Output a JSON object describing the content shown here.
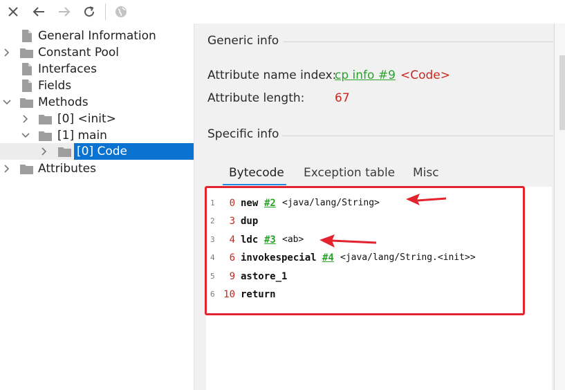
{
  "toolbar": {
    "buttons": [
      {
        "icon": "close-icon"
      },
      {
        "icon": "back-arrow-icon"
      },
      {
        "icon": "forward-arrow-icon"
      },
      {
        "icon": "refresh-icon"
      },
      {
        "icon": "globe-icon"
      }
    ]
  },
  "tree": {
    "items": [
      {
        "label": "General Information",
        "kind": "file"
      },
      {
        "label": "Constant Pool",
        "kind": "folder",
        "expanded": false
      },
      {
        "label": "Interfaces",
        "kind": "file"
      },
      {
        "label": "Fields",
        "kind": "file"
      },
      {
        "label": "Methods",
        "kind": "folder",
        "expanded": true
      },
      {
        "label": "[0] <init>",
        "kind": "folder",
        "expanded": false
      },
      {
        "label": "[1] main",
        "kind": "folder",
        "expanded": true
      },
      {
        "label": "[0] Code",
        "kind": "folder",
        "expanded": false,
        "selected": true
      },
      {
        "label": "Attributes",
        "kind": "folder",
        "expanded": false
      }
    ]
  },
  "generic": {
    "title": "Generic info",
    "name_index_label": "Attribute name index:",
    "name_index_link": "cp info #9",
    "name_index_value": "<Code>",
    "length_label": "Attribute length:",
    "length_value": "67"
  },
  "specific": {
    "title": "Specific info",
    "tabs": [
      "Bytecode",
      "Exception table",
      "Misc"
    ],
    "active_tab": "Bytecode"
  },
  "bytecode": [
    {
      "line": "1",
      "offset": "0",
      "op": "new",
      "link": "#2",
      "arg": "<java/lang/String>"
    },
    {
      "line": "2",
      "offset": "3",
      "op": "dup",
      "link": "",
      "arg": ""
    },
    {
      "line": "3",
      "offset": "4",
      "op": "ldc",
      "link": "#3",
      "arg": "<ab>"
    },
    {
      "line": "4",
      "offset": "6",
      "op": "invokespecial",
      "link": "#4",
      "arg": "<java/lang/String.<init>>"
    },
    {
      "line": "5",
      "offset": "9",
      "op": "astore_1",
      "link": "",
      "arg": ""
    },
    {
      "line": "6",
      "offset": "10",
      "op": "return",
      "link": "",
      "arg": ""
    }
  ],
  "colors": {
    "link": "#2aa22a",
    "value_red": "#c8281e",
    "annotation_red": "#e3232d",
    "selection": "#0a73d2"
  }
}
